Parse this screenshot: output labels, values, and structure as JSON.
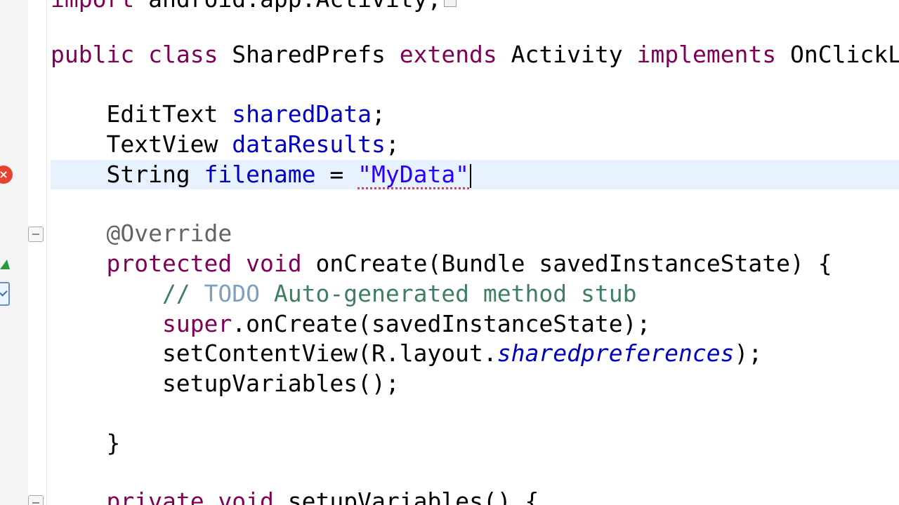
{
  "editor": {
    "lines": [
      {
        "id": "import",
        "tokens": [
          {
            "t": "import",
            "c": "kw"
          },
          {
            "t": " android.app.Activity;",
            "c": "plain"
          }
        ]
      },
      {
        "id": "class-decl",
        "tokens": [
          {
            "t": "public",
            "c": "kw"
          },
          {
            "t": " ",
            "c": "plain"
          },
          {
            "t": "class",
            "c": "kw"
          },
          {
            "t": " SharedPrefs ",
            "c": "plain"
          },
          {
            "t": "extends",
            "c": "kw"
          },
          {
            "t": " Activity ",
            "c": "plain"
          },
          {
            "t": "implements",
            "c": "kw"
          },
          {
            "t": " OnClickL",
            "c": "plain"
          }
        ]
      },
      {
        "id": "field-shareddata",
        "tokens": [
          {
            "t": "    EditText ",
            "c": "plain"
          },
          {
            "t": "sharedData",
            "c": "fld"
          },
          {
            "t": ";",
            "c": "plain"
          }
        ]
      },
      {
        "id": "field-dataresults",
        "tokens": [
          {
            "t": "    TextView ",
            "c": "plain"
          },
          {
            "t": "dataResults",
            "c": "fld"
          },
          {
            "t": ";",
            "c": "plain"
          }
        ]
      },
      {
        "id": "field-filename",
        "tokens": [
          {
            "t": "    String ",
            "c": "plain"
          },
          {
            "t": "filename",
            "c": "fld"
          },
          {
            "t": " = ",
            "c": "plain"
          },
          {
            "t": "\"MyData\"",
            "c": "str err-underline"
          }
        ],
        "current": true,
        "caret": true
      },
      {
        "id": "annotation",
        "tokens": [
          {
            "t": "    @Override",
            "c": "ann"
          }
        ]
      },
      {
        "id": "oncreate-decl",
        "tokens": [
          {
            "t": "    ",
            "c": "plain"
          },
          {
            "t": "protected",
            "c": "kw"
          },
          {
            "t": " ",
            "c": "plain"
          },
          {
            "t": "void",
            "c": "kw"
          },
          {
            "t": " onCreate(Bundle savedInstanceState) {",
            "c": "plain"
          }
        ]
      },
      {
        "id": "comment-todo",
        "tokens": [
          {
            "t": "        // ",
            "c": "cm"
          },
          {
            "t": "TODO",
            "c": "todo"
          },
          {
            "t": " Auto-generated method stub",
            "c": "cm"
          }
        ]
      },
      {
        "id": "super-call",
        "tokens": [
          {
            "t": "        ",
            "c": "plain"
          },
          {
            "t": "super",
            "c": "kw"
          },
          {
            "t": ".onCreate(savedInstanceState);",
            "c": "plain"
          }
        ]
      },
      {
        "id": "setcontentview",
        "tokens": [
          {
            "t": "        setContentView(R.layout.",
            "c": "plain"
          },
          {
            "t": "sharedpreferences",
            "c": "fld-static"
          },
          {
            "t": ");",
            "c": "plain"
          }
        ]
      },
      {
        "id": "setupvariables-call",
        "tokens": [
          {
            "t": "        setupVariables();",
            "c": "plain"
          }
        ]
      },
      {
        "id": "close-brace",
        "tokens": [
          {
            "t": "    }",
            "c": "plain"
          }
        ]
      },
      {
        "id": "setupvariables-decl",
        "tokens": [
          {
            "t": "    ",
            "c": "plain"
          },
          {
            "t": "private",
            "c": "kw"
          },
          {
            "t": " ",
            "c": "plain"
          },
          {
            "t": "void",
            "c": "kw"
          },
          {
            "t": " setupVariables() {",
            "c": "plain"
          }
        ]
      }
    ]
  },
  "markers": {
    "error_symbol": "×"
  }
}
